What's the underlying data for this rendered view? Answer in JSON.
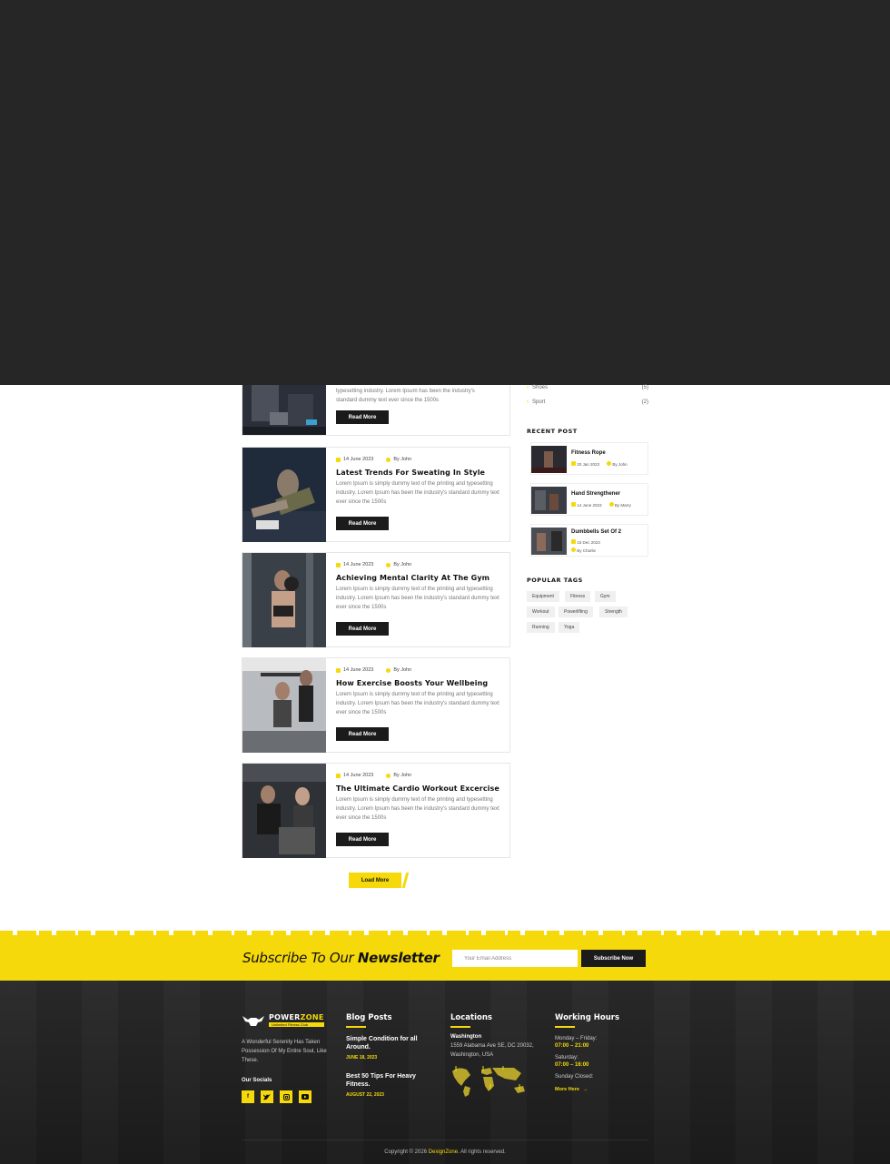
{
  "sidebar": {
    "categories": [
      {
        "name": "Shoes",
        "count": "(5)"
      },
      {
        "name": "Sport",
        "count": "(2)"
      }
    ],
    "recent_heading": "RECENT POST",
    "recent_posts": [
      {
        "title": "Fitness Rope",
        "date": "20 Jan 2023",
        "author": "By John"
      },
      {
        "title": "Hand Strengthener",
        "date": "14 June 2023",
        "author": "By Marry"
      },
      {
        "title": "Dumbbells Set Of 2",
        "date": "15 Dec 2023",
        "author": "By Charlie"
      }
    ],
    "tags_heading": "POPULAR TAGS",
    "tags": [
      "Equipment",
      "Fitness",
      "Gym",
      "Workout",
      "Powerlifting",
      "Strength",
      "Running",
      "Yoga"
    ]
  },
  "posts": [
    {
      "date": "14 June 2023",
      "author": "By John",
      "title": "",
      "excerpt_line2": "typesetting industry. Lorem Ipsum has been the industry's",
      "excerpt_line3": "standard dummy text ever since the 1500s",
      "read_more": "Read More"
    },
    {
      "date": "14 June 2023",
      "author": "By John",
      "title": "Latest Trends For Sweating In Style",
      "excerpt": "Lorem Ipsum is simply dummy text of the printing and typesetting industry. Lorem Ipsum has been the industry's standard dummy text ever since the 1500s",
      "read_more": "Read More"
    },
    {
      "date": "14 June 2023",
      "author": "By John",
      "title": "Achieving Mental Clarity At The Gym",
      "excerpt": "Lorem Ipsum is simply dummy text of the printing and typesetting industry. Lorem Ipsum has been the industry's standard dummy text ever since the 1500s",
      "read_more": "Read More"
    },
    {
      "date": "14 June 2023",
      "author": "By John",
      "title": "How Exercise Boosts Your Wellbeing",
      "excerpt": "Lorem Ipsum is simply dummy text of the printing and typesetting industry. Lorem Ipsum has been the industry's standard dummy text ever since the 1500s",
      "read_more": "Read More"
    },
    {
      "date": "14 June 2023",
      "author": "By John",
      "title": "The Ultimate Cardio Workout Excercise",
      "excerpt": "Lorem Ipsum is simply dummy text of the printing and typesetting industry. Lorem Ipsum has been the industry's standard dummy text ever since the 1500s",
      "read_more": "Read More"
    }
  ],
  "load_more": "Load More",
  "newsletter": {
    "title_light": "Subscribe To Our",
    "title_bold": "Newsletter",
    "placeholder": "Your Email Address",
    "button": "Subscribe Now"
  },
  "footer": {
    "logo_name_a": "POWER",
    "logo_name_b": "ZONE",
    "logo_sub": "Unlimited Fitness Club",
    "about": "A Wonderful Serenity Has Taken Possession Of My Entire Soul, Like These.",
    "socials_heading": "Our Socials",
    "blog_heading": "Blog Posts",
    "blog_posts": [
      {
        "title": "Simple Condition for all Around.",
        "date": "JUNE 18, 2023"
      },
      {
        "title": "Best 50 Tips For Heavy Fitness.",
        "date": "AUGUST 22, 2023"
      }
    ],
    "locations_heading": "Locations",
    "city": "Washington",
    "address": "1559 Alabama Ave SE, DC 20032, Washington, USA",
    "hours_heading": "Working Hours",
    "weekday_label": "Monday – Friday:",
    "weekday_hours": "07:00 – 21:00",
    "saturday_label": "Saturday:",
    "saturday_hours": "07:00 – 16:00",
    "sunday_label": "Sunday Closed:",
    "more_here": "More Here",
    "copyright_a": "Copyright © 2026 ",
    "copyright_brand": "DexignZone",
    "copyright_b": ". All rights reserved."
  },
  "colors": {
    "accent": "#f5d90a",
    "dark": "#1b1b1b",
    "hero": "#262626"
  }
}
